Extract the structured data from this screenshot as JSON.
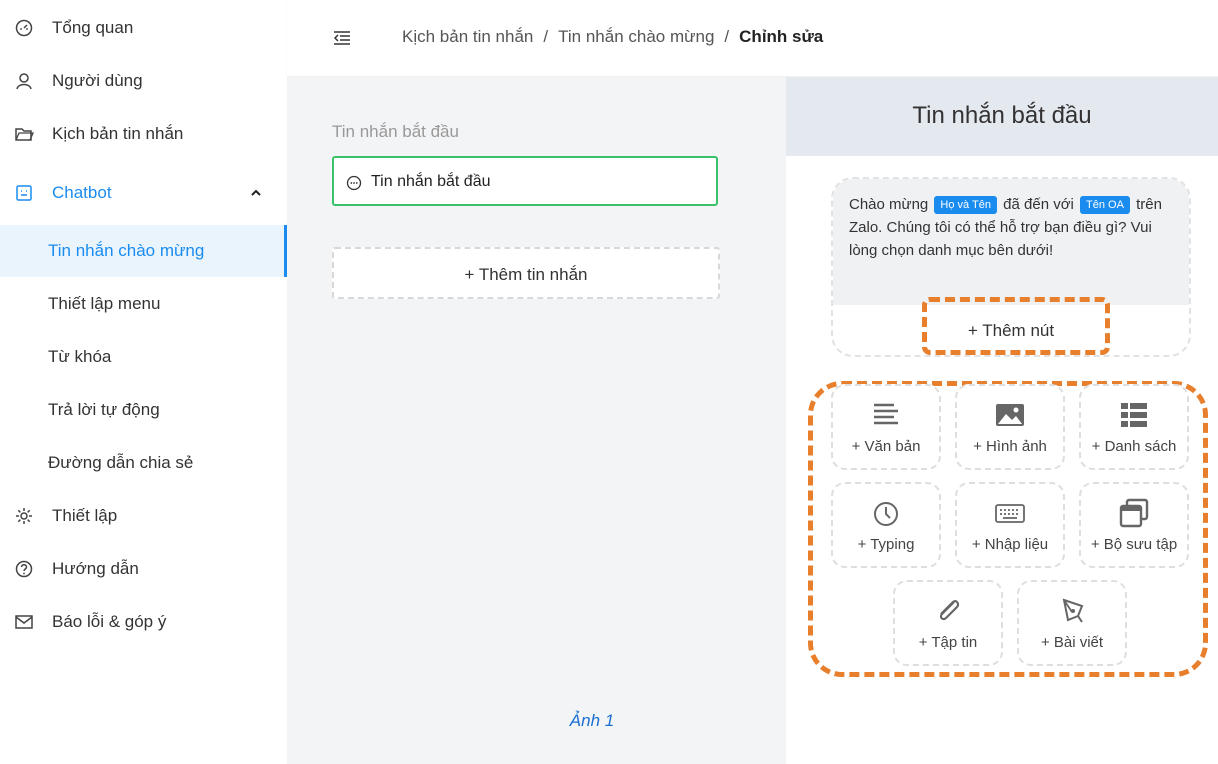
{
  "sidebar": {
    "items": [
      {
        "label": "Tổng quan",
        "icon": "dashboard-icon"
      },
      {
        "label": "Người dùng",
        "icon": "user-icon"
      },
      {
        "label": "Kịch bản tin nhắn",
        "icon": "folder-icon"
      },
      {
        "label": "Chatbot",
        "icon": "chatbot-icon"
      },
      {
        "label": "Tin nhắn chào mừng"
      },
      {
        "label": "Thiết lập menu"
      },
      {
        "label": "Từ khóa"
      },
      {
        "label": "Trả lời tự động"
      },
      {
        "label": "Đường dẫn chia sẻ"
      },
      {
        "label": "Thiết lập",
        "icon": "gear-icon"
      },
      {
        "label": "Hướng dẫn",
        "icon": "help-icon"
      },
      {
        "label": "Báo lỗi & góp ý",
        "icon": "mail-icon"
      }
    ]
  },
  "header": {
    "breadcrumb": [
      "Kịch bản tin nhắn",
      "Tin nhắn chào mừng",
      "Chỉnh sửa"
    ],
    "separator": "/"
  },
  "middle": {
    "section_label": "Tin nhắn bắt đầu",
    "start_card_label": "Tin nhắn bắt đầu",
    "add_message_label": "+  Thêm tin nhắn",
    "caption": "Ảnh 1"
  },
  "preview": {
    "title": "Tin nhắn bắt đầu",
    "msg_part1": "Chào mừng ",
    "tag_name": "Họ và Tên",
    "msg_part2": " đã đến với ",
    "tag_oa": "Tên OA",
    "msg_part3": " trên Zalo. Chúng tôi có thể hỗ trợ bạn điều gì? Vui lòng chọn danh mục bên dưới!",
    "add_button_label": "+  Thêm nút"
  },
  "tiles": [
    {
      "label": "+ Văn bản",
      "icon": "text-lines-icon"
    },
    {
      "label": "+ Hình ảnh",
      "icon": "image-icon"
    },
    {
      "label": "+ Danh sách",
      "icon": "list-icon"
    },
    {
      "label": "+ Typing",
      "icon": "clock-icon"
    },
    {
      "label": "+ Nhập liệu",
      "icon": "keyboard-icon"
    },
    {
      "label": "+ Bộ sưu tập",
      "icon": "gallery-icon"
    },
    {
      "label": "+ Tập tin",
      "icon": "paperclip-icon"
    },
    {
      "label": "+ Bài viết",
      "icon": "pen-icon"
    }
  ],
  "colors": {
    "accent": "#1a8cf0",
    "highlight": "#e87f2d",
    "selected_border": "#39c26a"
  }
}
